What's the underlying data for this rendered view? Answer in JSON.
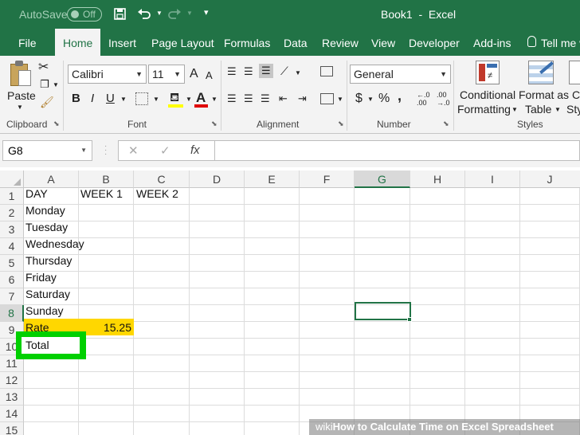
{
  "titlebar": {
    "autosave_label": "AutoSave",
    "autosave_state": "Off",
    "title": "Book1  -  Excel"
  },
  "tabs": [
    {
      "label": "File"
    },
    {
      "label": "Home"
    },
    {
      "label": "Insert"
    },
    {
      "label": "Page Layout"
    },
    {
      "label": "Formulas"
    },
    {
      "label": "Data"
    },
    {
      "label": "Review"
    },
    {
      "label": "View"
    },
    {
      "label": "Developer"
    },
    {
      "label": "Add-ins"
    },
    {
      "label": "Tell me w"
    }
  ],
  "ribbon": {
    "clipboard": {
      "paste_label": "Paste",
      "group_label": "Clipboard"
    },
    "font": {
      "font_name": "Calibri",
      "font_size": "11",
      "grow": "A",
      "shrink": "A",
      "bold": "B",
      "italic": "I",
      "underline": "U",
      "font_color_glyph": "A",
      "group_label": "Font"
    },
    "alignment": {
      "group_label": "Alignment"
    },
    "number": {
      "format": "General",
      "currency": "$",
      "percent": "%",
      "comma": ",",
      "group_label": "Number"
    },
    "styles": {
      "cond_fmt_l1": "Conditional",
      "cond_fmt_l2": "Formatting",
      "table_l1": "Format as",
      "table_l2": "Table",
      "cell_l1": "C",
      "cell_l2": "Sty",
      "group_label": "Styles"
    }
  },
  "formula_bar": {
    "name_box": "G8",
    "fx_label": "fx",
    "cancel_glyph": "✕",
    "enter_glyph": "✓",
    "value": ""
  },
  "columns": [
    "A",
    "B",
    "C",
    "D",
    "E",
    "F",
    "G",
    "H",
    "I",
    "J"
  ],
  "rows": [
    "1",
    "2",
    "3",
    "4",
    "5",
    "6",
    "7",
    "8",
    "9",
    "10",
    "11",
    "12",
    "13",
    "14",
    "15"
  ],
  "cells": {
    "A1": "DAY",
    "B1": "WEEK 1",
    "C1": "WEEK 2",
    "A2": "Monday",
    "A3": "Tuesday",
    "A4": "Wednesday",
    "A5": "Thursday",
    "A6": "Friday",
    "A7": "Saturday",
    "A8": "Sunday",
    "A9": "Rate",
    "B9": "15.25",
    "A10": "Total"
  },
  "colors": {
    "excel_green": "#217346",
    "rate_fill": "#ffd700",
    "highlight_green": "#00d000"
  },
  "watermark": {
    "brand": "wiki",
    "text": "How to Calculate Time on Excel Spreadsheet"
  }
}
